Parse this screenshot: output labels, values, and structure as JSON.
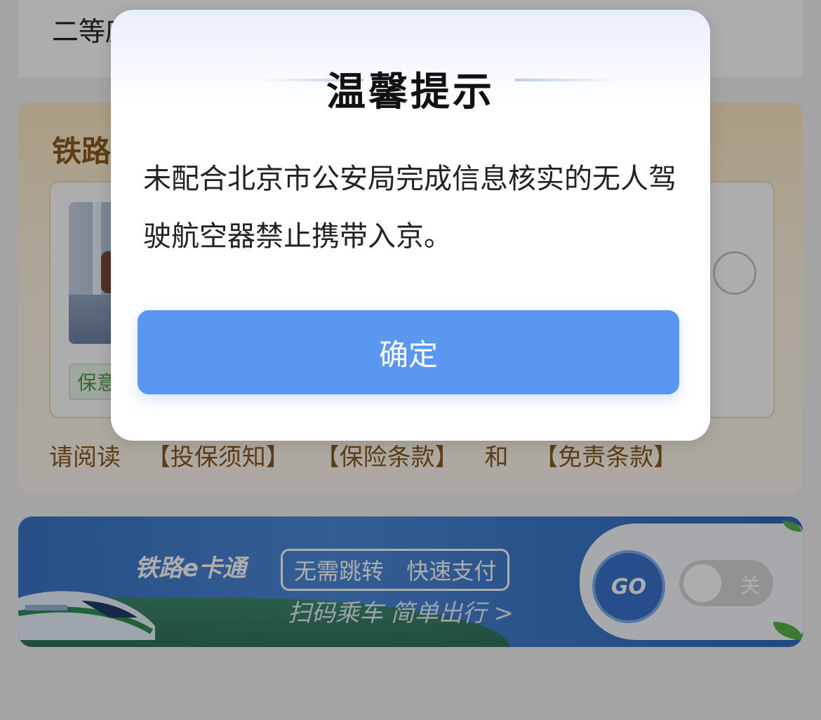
{
  "background": {
    "seat_card": {
      "text": "二等座"
    },
    "insurance": {
      "title": "铁路乘意险",
      "tag": "保意外",
      "read_prefix": "请阅读",
      "links": [
        "【投保须知】",
        "【保险条款】",
        "和",
        "【免责条款】"
      ]
    },
    "banner": {
      "logo": "铁路e卡通",
      "pill_items": [
        "无需跳转",
        "快速支付"
      ],
      "subtitle": "扫码乘车 简单出行 >",
      "go_label": "GO",
      "toggle_label": "关"
    }
  },
  "dialog": {
    "title": "温馨提示",
    "message": "未配合北京市公安局完成信息核实的无人驾驶航空器禁止携带入京。",
    "confirm_label": "确定"
  },
  "colors": {
    "accent_button": "#5a97f1",
    "insurance_text": "#8a5a1f",
    "banner_blue": "#3b76c7"
  }
}
